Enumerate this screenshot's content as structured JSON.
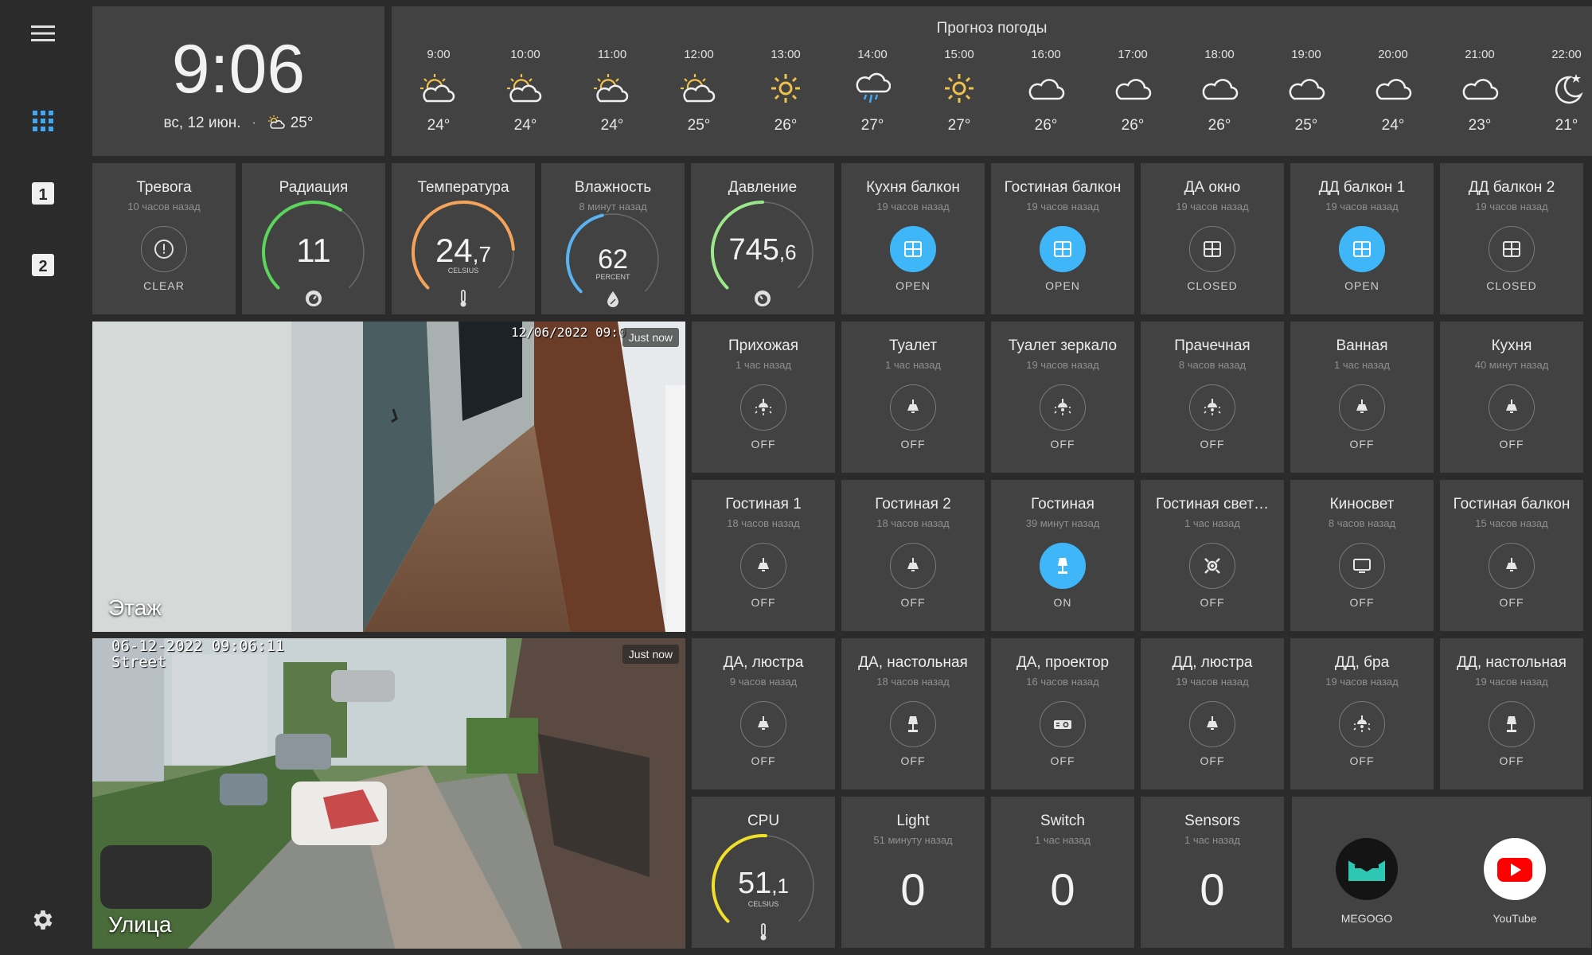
{
  "clock": {
    "time": "9:06",
    "date": "вс, 12 июн.",
    "weather_temp": "25°"
  },
  "forecast": {
    "title": "Прогноз погоды",
    "hours": [
      {
        "time": "9:00",
        "temp": "24°",
        "icon": "partly-cloudy-icon"
      },
      {
        "time": "10:00",
        "temp": "24°",
        "icon": "partly-cloudy-icon"
      },
      {
        "time": "11:00",
        "temp": "24°",
        "icon": "partly-cloudy-icon"
      },
      {
        "time": "12:00",
        "temp": "25°",
        "icon": "partly-cloudy-icon"
      },
      {
        "time": "13:00",
        "temp": "26°",
        "icon": "sunny-icon"
      },
      {
        "time": "14:00",
        "temp": "27°",
        "icon": "rain-icon"
      },
      {
        "time": "15:00",
        "temp": "27°",
        "icon": "sunny-icon"
      },
      {
        "time": "16:00",
        "temp": "26°",
        "icon": "cloudy-icon"
      },
      {
        "time": "17:00",
        "temp": "26°",
        "icon": "cloudy-icon"
      },
      {
        "time": "18:00",
        "temp": "26°",
        "icon": "cloudy-icon"
      },
      {
        "time": "19:00",
        "temp": "25°",
        "icon": "cloudy-icon"
      },
      {
        "time": "20:00",
        "temp": "24°",
        "icon": "cloudy-icon"
      },
      {
        "time": "21:00",
        "temp": "23°",
        "icon": "cloudy-icon"
      },
      {
        "time": "22:00",
        "temp": "21°",
        "icon": "night-icon"
      }
    ]
  },
  "sensors": {
    "alarm": {
      "title": "Тревога",
      "sub": "10 часов назад",
      "state": "CLEAR"
    },
    "radiation": {
      "title": "Радиация",
      "value": "11",
      "fraction": 0.62,
      "color": "#5bd65b"
    },
    "temperature": {
      "title": "Температура",
      "int": "24",
      "dec": ",7",
      "unit": "CELSIUS",
      "fraction": 0.82,
      "color": "#f5a35a"
    },
    "humidity": {
      "title": "Влажность",
      "sub": "8 минут назад",
      "value": "62",
      "unit": "PERCENT",
      "fraction": 0.45,
      "color": "#5ab3f0"
    },
    "pressure": {
      "title": "Давление",
      "int": "745",
      "dec": ",6",
      "fraction": 0.5,
      "color": "#9be88a"
    }
  },
  "row1": [
    {
      "name": "kitchen-balcony",
      "title": "Кухня балкон",
      "sub": "19 часов назад",
      "state": "OPEN",
      "on": true,
      "icon": "window-icon"
    },
    {
      "name": "living-balcony",
      "title": "Гостиная балкон",
      "sub": "19 часов назад",
      "state": "OPEN",
      "on": true,
      "icon": "window-icon"
    },
    {
      "name": "da-window",
      "title": "ДА окно",
      "sub": "19 часов назад",
      "state": "CLOSED",
      "on": false,
      "icon": "window-icon"
    },
    {
      "name": "dd-balcony-1",
      "title": "ДД балкон 1",
      "sub": "19 часов назад",
      "state": "OPEN",
      "on": true,
      "icon": "window-icon"
    },
    {
      "name": "dd-balcony-2",
      "title": "ДД балкон 2",
      "sub": "19 часов назад",
      "state": "CLOSED",
      "on": false,
      "icon": "window-icon"
    }
  ],
  "row2": [
    {
      "name": "hallway",
      "title": "Прихожая",
      "sub": "1 час назад",
      "state": "OFF",
      "on": false,
      "icon": "ceiling-light-icon"
    },
    {
      "name": "toilet",
      "title": "Туалет",
      "sub": "1 час назад",
      "state": "OFF",
      "on": false,
      "icon": "lamp-icon"
    },
    {
      "name": "toilet-mirror",
      "title": "Туалет зеркало",
      "sub": "19 часов назад",
      "state": "OFF",
      "on": false,
      "icon": "ceiling-light-icon"
    },
    {
      "name": "laundry",
      "title": "Прачечная",
      "sub": "8 часов назад",
      "state": "OFF",
      "on": false,
      "icon": "ceiling-light-icon"
    },
    {
      "name": "bathroom",
      "title": "Ванная",
      "sub": "1 час назад",
      "state": "OFF",
      "on": false,
      "icon": "lamp-icon"
    },
    {
      "name": "kitchen",
      "title": "Кухня",
      "sub": "40 минут назад",
      "state": "OFF",
      "on": false,
      "icon": "lamp-icon"
    }
  ],
  "row3": [
    {
      "name": "living-1",
      "title": "Гостиная 1",
      "sub": "18 часов назад",
      "state": "OFF",
      "on": false,
      "icon": "lamp-icon"
    },
    {
      "name": "living-2",
      "title": "Гостиная 2",
      "sub": "18 часов назад",
      "state": "OFF",
      "on": false,
      "icon": "lamp-icon"
    },
    {
      "name": "living",
      "title": "Гостиная",
      "sub": "39 минут назад",
      "state": "ON",
      "on": true,
      "icon": "floor-lamp-icon"
    },
    {
      "name": "living-light",
      "title": "Гостиная свет…",
      "sub": "1 час назад",
      "state": "OFF",
      "on": false,
      "icon": "spotlight-icon"
    },
    {
      "name": "cinema-light",
      "title": "Киносвет",
      "sub": "8 часов назад",
      "state": "OFF",
      "on": false,
      "icon": "monitor-icon"
    },
    {
      "name": "living-balcony-light",
      "title": "Гостиная балкон",
      "sub": "15 часов назад",
      "state": "OFF",
      "on": false,
      "icon": "lamp-icon"
    }
  ],
  "row4": [
    {
      "name": "da-chandelier",
      "title": "ДА, люстра",
      "sub": "9 часов назад",
      "state": "OFF",
      "on": false,
      "icon": "lamp-icon"
    },
    {
      "name": "da-desk",
      "title": "ДА, настольная",
      "sub": "18 часов назад",
      "state": "OFF",
      "on": false,
      "icon": "floor-lamp-icon"
    },
    {
      "name": "da-projector",
      "title": "ДА, проектор",
      "sub": "16 часов назад",
      "state": "OFF",
      "on": false,
      "icon": "projector-icon"
    },
    {
      "name": "dd-chandelier",
      "title": "ДД, люстра",
      "sub": "19 часов назад",
      "state": "OFF",
      "on": false,
      "icon": "lamp-icon"
    },
    {
      "name": "dd-sconce",
      "title": "ДД, бра",
      "sub": "19 часов назад",
      "state": "OFF",
      "on": false,
      "icon": "ceiling-light-icon"
    },
    {
      "name": "dd-desk",
      "title": "ДД, настольная",
      "sub": "19 часов назад",
      "state": "OFF",
      "on": false,
      "icon": "floor-lamp-icon"
    }
  ],
  "cpu": {
    "title": "CPU",
    "int": "51",
    "dec": ",1",
    "unit": "CELSIUS",
    "fraction": 0.51,
    "color": "#f0e02a"
  },
  "counters": [
    {
      "name": "light-counter",
      "title": "Light",
      "sub": "51 минуту назад",
      "value": "0"
    },
    {
      "name": "switch-counter",
      "title": "Switch",
      "sub": "1 час назад",
      "value": "0"
    },
    {
      "name": "sensors-counter",
      "title": "Sensors",
      "sub": "1 час назад",
      "value": "0"
    }
  ],
  "apps": [
    {
      "name": "megogo",
      "label": "MEGOGO"
    },
    {
      "name": "youtube",
      "label": "YouTube"
    }
  ],
  "cameras": {
    "floor": {
      "label": "Этаж",
      "badge": "Just now",
      "stamp": "12/06/2022 09:0"
    },
    "street": {
      "label": "Улица",
      "badge": "Just now",
      "stamp": "06-12-2022 09:06:11",
      "stamp2": "Street"
    }
  }
}
